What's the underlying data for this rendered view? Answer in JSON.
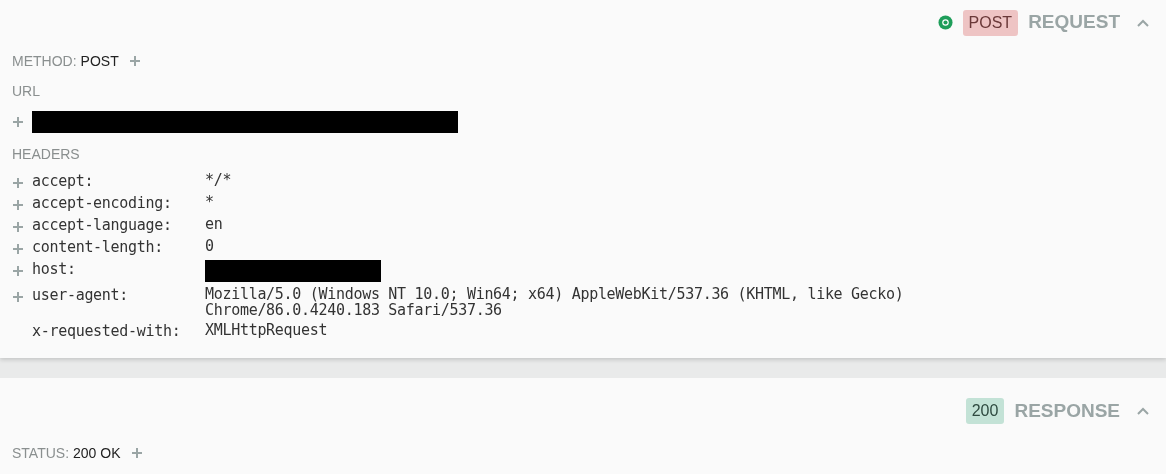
{
  "request": {
    "method_badge": "POST",
    "title": "REQUEST",
    "expanded": true,
    "method": {
      "label": "METHOD:",
      "value": "POST"
    },
    "url": {
      "heading": "URL",
      "kind": "redacted"
    },
    "headers": {
      "heading": "HEADERS",
      "items": [
        {
          "name": "accept:",
          "kind": "text",
          "value": "*/*",
          "addable": true
        },
        {
          "name": "accept-encoding:",
          "kind": "text",
          "value": "*",
          "addable": true
        },
        {
          "name": "accept-language:",
          "kind": "text",
          "value": "en",
          "addable": true
        },
        {
          "name": "content-length:",
          "kind": "text",
          "value": "0",
          "addable": true
        },
        {
          "name": "host:",
          "kind": "redacted",
          "addable": true
        },
        {
          "name": "user-agent:",
          "kind": "text",
          "value": "Mozilla/5.0 (Windows NT 10.0; Win64; x64) AppleWebKit/537.36 (KHTML, like Gecko) Chrome/86.0.4240.183 Safari/537.36",
          "addable": true
        },
        {
          "name": "x-requested-with:",
          "kind": "text",
          "value": "XMLHttpRequest",
          "addable": false
        }
      ]
    }
  },
  "response": {
    "status_badge": "200",
    "title": "RESPONSE",
    "expanded": true,
    "status": {
      "label": "STATUS:",
      "value": "200 OK"
    }
  }
}
